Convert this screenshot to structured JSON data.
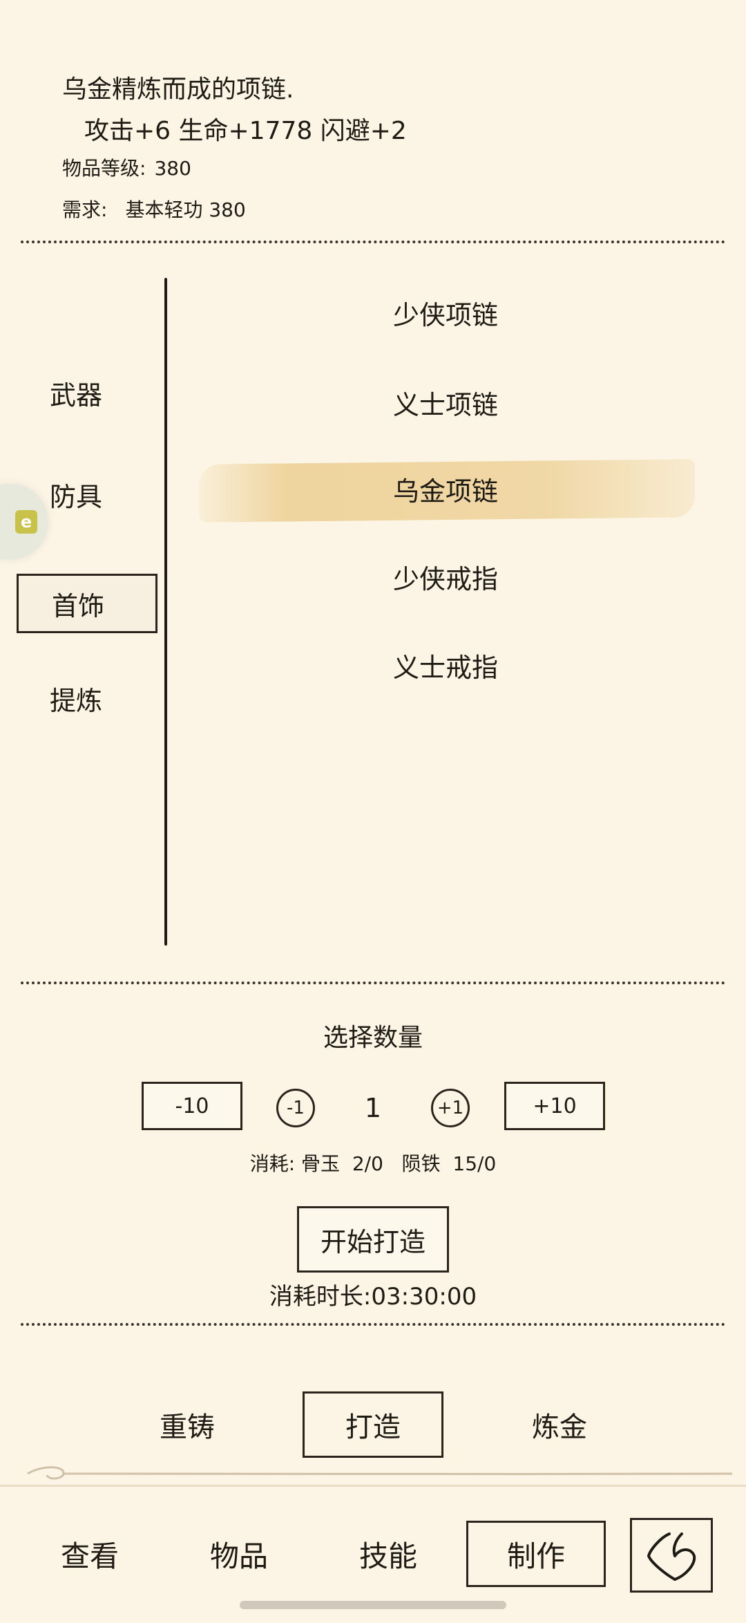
{
  "item_detail": {
    "description": "乌金精炼而成的项链.",
    "stats": "攻击+6 生命+1778 闪避+2",
    "level_label": "物品等级:",
    "level_value": "380",
    "requirement_label": "需求:",
    "requirement_value": "基本轻功 380"
  },
  "categories": [
    {
      "label": "武器",
      "selected": false
    },
    {
      "label": "防具",
      "selected": false
    },
    {
      "label": "首饰",
      "selected": true
    },
    {
      "label": "提炼",
      "selected": false
    }
  ],
  "recipes": [
    {
      "label": "少侠项链",
      "selected": false
    },
    {
      "label": "义士项链",
      "selected": false
    },
    {
      "label": "乌金项链",
      "selected": true
    },
    {
      "label": "少侠戒指",
      "selected": false
    },
    {
      "label": "义士戒指",
      "selected": false
    }
  ],
  "quantity": {
    "title": "选择数量",
    "minus10_label": "-10",
    "minus1_label": "-1",
    "value": "1",
    "plus1_label": "+1",
    "plus10_label": "+10",
    "cost": "消耗: 骨玉  2/0   陨铁  15/0",
    "start_label": "开始打造",
    "duration": "消耗时长:03:30:00"
  },
  "sub_tabs": [
    {
      "label": "重铸",
      "selected": false
    },
    {
      "label": "打造",
      "selected": true
    },
    {
      "label": "炼金",
      "selected": false
    }
  ],
  "nav_tabs": [
    {
      "label": "查看",
      "selected": false
    },
    {
      "label": "物品",
      "selected": false
    },
    {
      "label": "技能",
      "selected": false
    },
    {
      "label": "制作",
      "selected": true
    }
  ],
  "icons": {
    "back": "back-heart-icon",
    "side_widget": "floating-assistant-icon"
  },
  "colors": {
    "background": "#fcf5e5",
    "ink": "#1e1a14",
    "highlight": "#ecce91"
  }
}
